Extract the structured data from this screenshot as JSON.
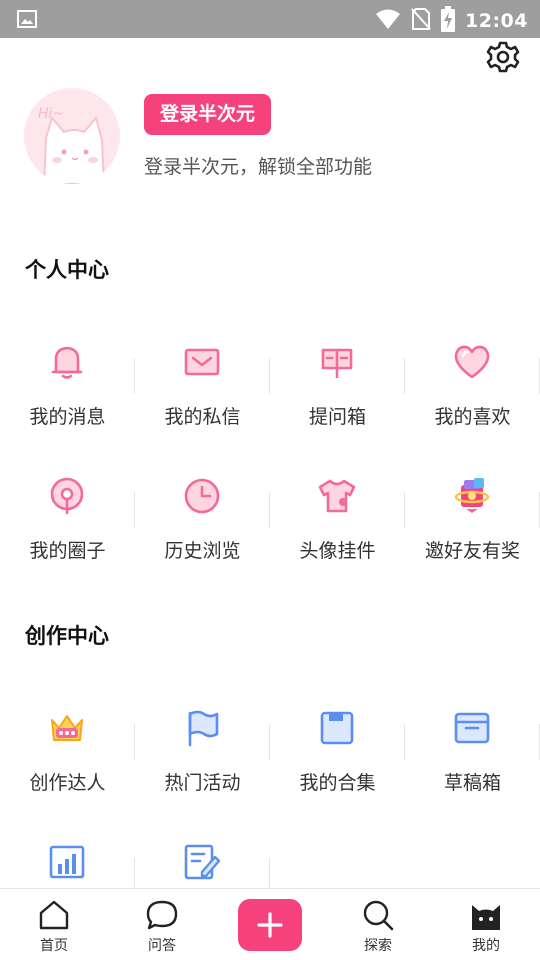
{
  "status_bar": {
    "time": "12:04"
  },
  "profile": {
    "login_button": "登录半次元",
    "login_hint": "登录半次元，解锁全部功能",
    "avatar_text": "Hi~"
  },
  "personal_center": {
    "title": "个人中心",
    "items": [
      {
        "label": "我的消息",
        "icon": "bell-icon"
      },
      {
        "label": "我的私信",
        "icon": "envelope-icon"
      },
      {
        "label": "提问箱",
        "icon": "mailbox-icon"
      },
      {
        "label": "我的喜欢",
        "icon": "heart-icon"
      },
      {
        "label": "我的圈子",
        "icon": "location-pin-icon"
      },
      {
        "label": "历史浏览",
        "icon": "clock-icon"
      },
      {
        "label": "头像挂件",
        "icon": "shirt-icon"
      },
      {
        "label": "邀好友有奖",
        "icon": "gift-planet-icon"
      }
    ]
  },
  "creation_center": {
    "title": "创作中心",
    "items": [
      {
        "label": "创作达人",
        "icon": "crown-icon"
      },
      {
        "label": "热门活动",
        "icon": "flag-icon"
      },
      {
        "label": "我的合集",
        "icon": "folder-icon"
      },
      {
        "label": "草稿箱",
        "icon": "archive-box-icon"
      },
      {
        "label": "",
        "icon": "bar-chart-icon"
      },
      {
        "label": "",
        "icon": "edit-note-icon"
      }
    ]
  },
  "bottom_nav": {
    "items": [
      {
        "label": "首页",
        "icon": "home-icon"
      },
      {
        "label": "问答",
        "icon": "chat-bubble-icon"
      },
      {
        "label": "探索",
        "icon": "search-icon"
      },
      {
        "label": "我的",
        "icon": "cat-face-icon"
      }
    ]
  },
  "colors": {
    "accent": "#f5427c",
    "pink_icon": "#f46a96",
    "blue_icon": "#5a8ff0",
    "status_bar": "#9e9e9e"
  }
}
